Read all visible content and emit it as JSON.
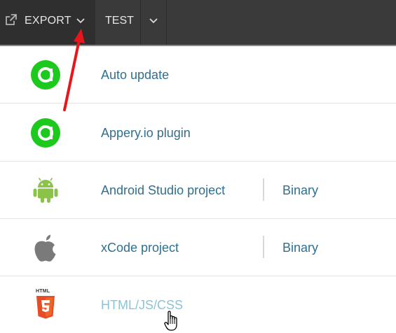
{
  "toolbar": {
    "export_label": "EXPORT",
    "test_label": "TEST"
  },
  "menu": {
    "items": [
      {
        "label": "Auto update",
        "icon": "appery-logo-icon"
      },
      {
        "label": "Appery.io plugin",
        "icon": "appery-logo-icon"
      },
      {
        "label": "Android Studio project",
        "icon": "android-icon",
        "secondary": "Binary"
      },
      {
        "label": "xCode project",
        "icon": "apple-icon",
        "secondary": "Binary"
      },
      {
        "label": "HTML/JS/CSS",
        "icon": "html5-icon",
        "icon_text": "HTML"
      }
    ]
  },
  "colors": {
    "toolbar_bg": "#3a3a3a",
    "export_bg": "#2f2f2f",
    "link": "#2f6f8f",
    "link_hover": "#8cc3d8",
    "appery_green": "#1ec91e",
    "android_green": "#8bc34a",
    "apple_gray": "#7a7a7a",
    "html5_orange": "#e44d26",
    "annotation_arrow": "#e8161b"
  }
}
